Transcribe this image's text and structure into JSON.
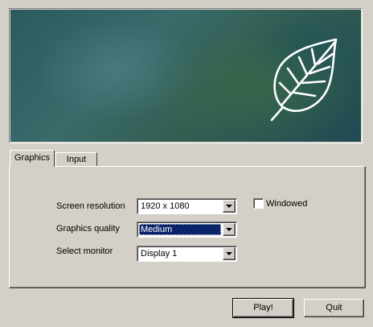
{
  "banner": {
    "image": "leaf-logo"
  },
  "tabs": [
    {
      "label": "Graphics",
      "active": true
    },
    {
      "label": "Input",
      "active": false
    }
  ],
  "settings": {
    "resolution": {
      "label": "Screen resolution",
      "value": "1920 x 1080"
    },
    "quality": {
      "label": "Graphics quality",
      "value": "Medium"
    },
    "monitor": {
      "label": "Select monitor",
      "value": "Display 1"
    },
    "windowed": {
      "label": "Windowed",
      "checked": false
    }
  },
  "buttons": {
    "play": "Play!",
    "quit": "Quit"
  },
  "colors": {
    "selection": "#0a246a",
    "face": "#d4d0c8"
  }
}
